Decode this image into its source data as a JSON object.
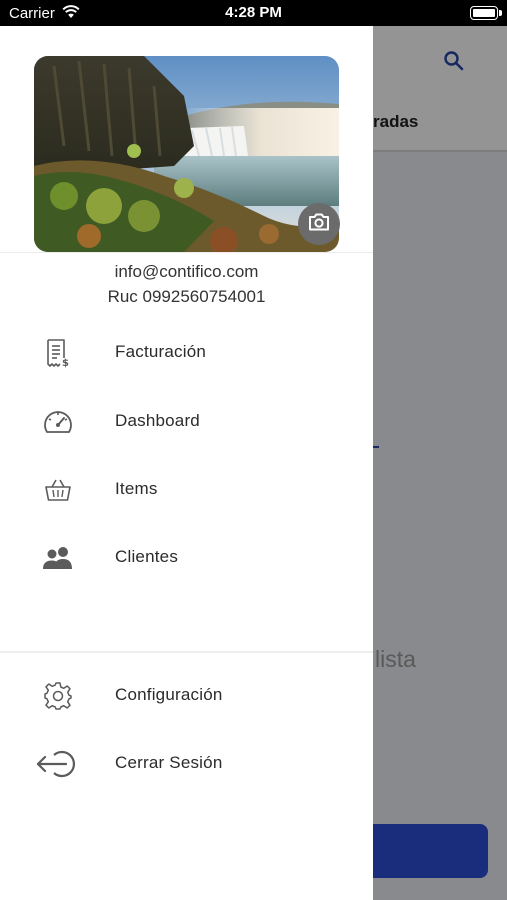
{
  "status_bar": {
    "carrier": "Carrier",
    "time": "4:28 PM"
  },
  "background_app": {
    "tab_label": "radas",
    "empty_text": "lista",
    "accent_color": "#2c4fd6",
    "search_icon": "search-icon"
  },
  "drawer": {
    "cover_image": "waterfall-landscape",
    "camera_icon": "camera-icon",
    "email": "info@contifico.com",
    "ruc": "Ruc 0992560754001",
    "menu": [
      {
        "label": "Facturación",
        "icon": "invoice-icon"
      },
      {
        "label": "Dashboard",
        "icon": "speedometer-icon"
      },
      {
        "label": "Items",
        "icon": "basket-icon"
      },
      {
        "label": "Clientes",
        "icon": "users-icon"
      }
    ],
    "footer_menu": [
      {
        "label": "Configuración",
        "icon": "gear-icon"
      },
      {
        "label": "Cerrar Sesión",
        "icon": "logout-icon"
      }
    ]
  }
}
